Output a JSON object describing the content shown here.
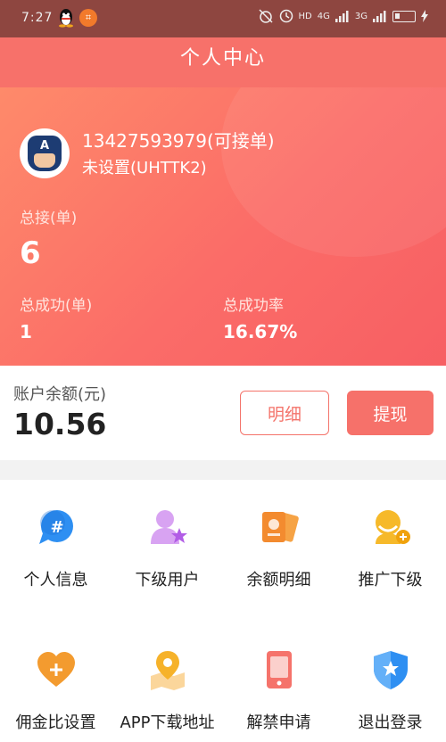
{
  "status_bar": {
    "time": "7:27",
    "network": "4G",
    "network2": "3G",
    "hd": "HD",
    "battery": "2"
  },
  "header": {
    "title": "个人中心"
  },
  "profile": {
    "phone_status": "13427593979(可接单)",
    "nickname": "未设置(UHTTK2)",
    "total_label": "总接(单)",
    "total_value": "6",
    "success_label": "总成功(单)",
    "success_value": "1",
    "rate_label": "总成功率",
    "rate_value": "16.67%"
  },
  "balance": {
    "label": "账户余额(元)",
    "amount": "10.56",
    "detail_button": "明细",
    "withdraw_button": "提现"
  },
  "menu": {
    "items": [
      {
        "label": "个人信息",
        "icon": "chat-hash-icon"
      },
      {
        "label": "下级用户",
        "icon": "user-star-icon"
      },
      {
        "label": "余额明细",
        "icon": "cards-icon"
      },
      {
        "label": "推广下级",
        "icon": "user-add-icon"
      },
      {
        "label": "佣金比设置",
        "icon": "heart-plus-icon"
      },
      {
        "label": "APP下载地址",
        "icon": "map-pin-icon"
      },
      {
        "label": "解禁申请",
        "icon": "phone-icon"
      },
      {
        "label": "退出登录",
        "icon": "shield-star-icon"
      }
    ]
  },
  "colors": {
    "accent": "#f6716a",
    "header": "#f7716a",
    "status_bar": "#8e4640"
  }
}
